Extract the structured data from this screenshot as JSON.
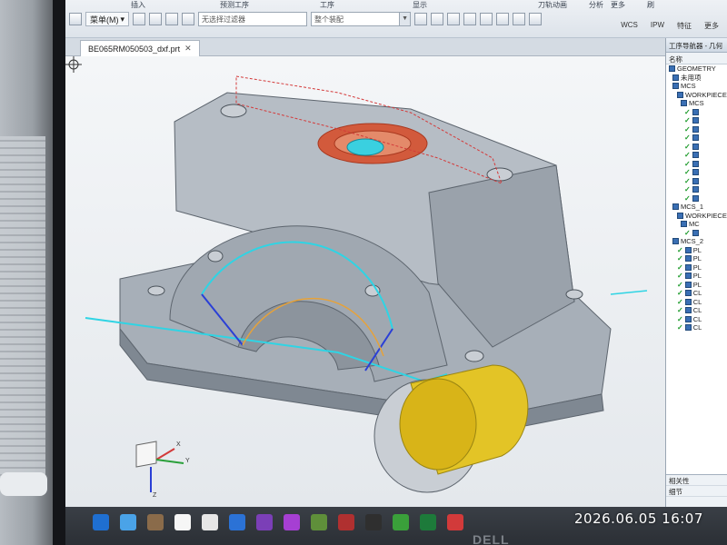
{
  "ribbon": {
    "top_labels": [
      "插入",
      "预测工序",
      "工序",
      "显示",
      "刀轨动画",
      "分析",
      "更多",
      "刷"
    ],
    "menu_label": "菜单(M)",
    "filter_placeholder": "无选择过滤器",
    "assembly_value": "整个装配",
    "right_buttons": [
      "WCS",
      "IPW",
      "特征",
      "更多"
    ]
  },
  "document": {
    "tab_label": "BE065RM050503_dxf.prt"
  },
  "navigator": {
    "title": "工序导航器 - 几何",
    "header": "名称",
    "rows": [
      {
        "text": "GEOMETRY",
        "level": 0,
        "checked": false
      },
      {
        "text": "未用项",
        "level": 1,
        "checked": false
      },
      {
        "text": "MCS",
        "level": 1,
        "checked": false
      },
      {
        "text": "WORKPIECE",
        "level": 2,
        "checked": false
      },
      {
        "text": "MCS",
        "level": 3,
        "checked": false
      },
      {
        "text": "",
        "level": 4,
        "checked": true
      },
      {
        "text": "",
        "level": 4,
        "checked": true
      },
      {
        "text": "",
        "level": 4,
        "checked": true
      },
      {
        "text": "",
        "level": 4,
        "checked": true
      },
      {
        "text": "",
        "level": 4,
        "checked": true
      },
      {
        "text": "",
        "level": 4,
        "checked": true
      },
      {
        "text": "",
        "level": 4,
        "checked": true
      },
      {
        "text": "",
        "level": 4,
        "checked": true
      },
      {
        "text": "",
        "level": 4,
        "checked": true
      },
      {
        "text": "",
        "level": 4,
        "checked": true
      },
      {
        "text": "",
        "level": 4,
        "checked": true
      },
      {
        "text": "MCS_1",
        "level": 1,
        "checked": false
      },
      {
        "text": "WORKPIECE",
        "level": 2,
        "checked": false
      },
      {
        "text": "MC",
        "level": 3,
        "checked": false
      },
      {
        "text": "",
        "level": 4,
        "checked": true
      },
      {
        "text": "MCS_2",
        "level": 1,
        "checked": false
      },
      {
        "text": "PL",
        "level": 2,
        "checked": true
      },
      {
        "text": "PL",
        "level": 2,
        "checked": true
      },
      {
        "text": "PL",
        "level": 2,
        "checked": true
      },
      {
        "text": "PL",
        "level": 2,
        "checked": true
      },
      {
        "text": "PL",
        "level": 2,
        "checked": true
      },
      {
        "text": "CL",
        "level": 2,
        "checked": true
      },
      {
        "text": "CL",
        "level": 2,
        "checked": true
      },
      {
        "text": "CL",
        "level": 2,
        "checked": true
      },
      {
        "text": "CL",
        "level": 2,
        "checked": true
      },
      {
        "text": "CL",
        "level": 2,
        "checked": true
      }
    ],
    "bottom": [
      "相关性",
      "细节"
    ]
  },
  "triad": {
    "x_label": "X",
    "y_label": "Y",
    "z_label": "Z"
  },
  "timestamp": "2026.06.05  16:07",
  "monitor_brand": "DELL"
}
